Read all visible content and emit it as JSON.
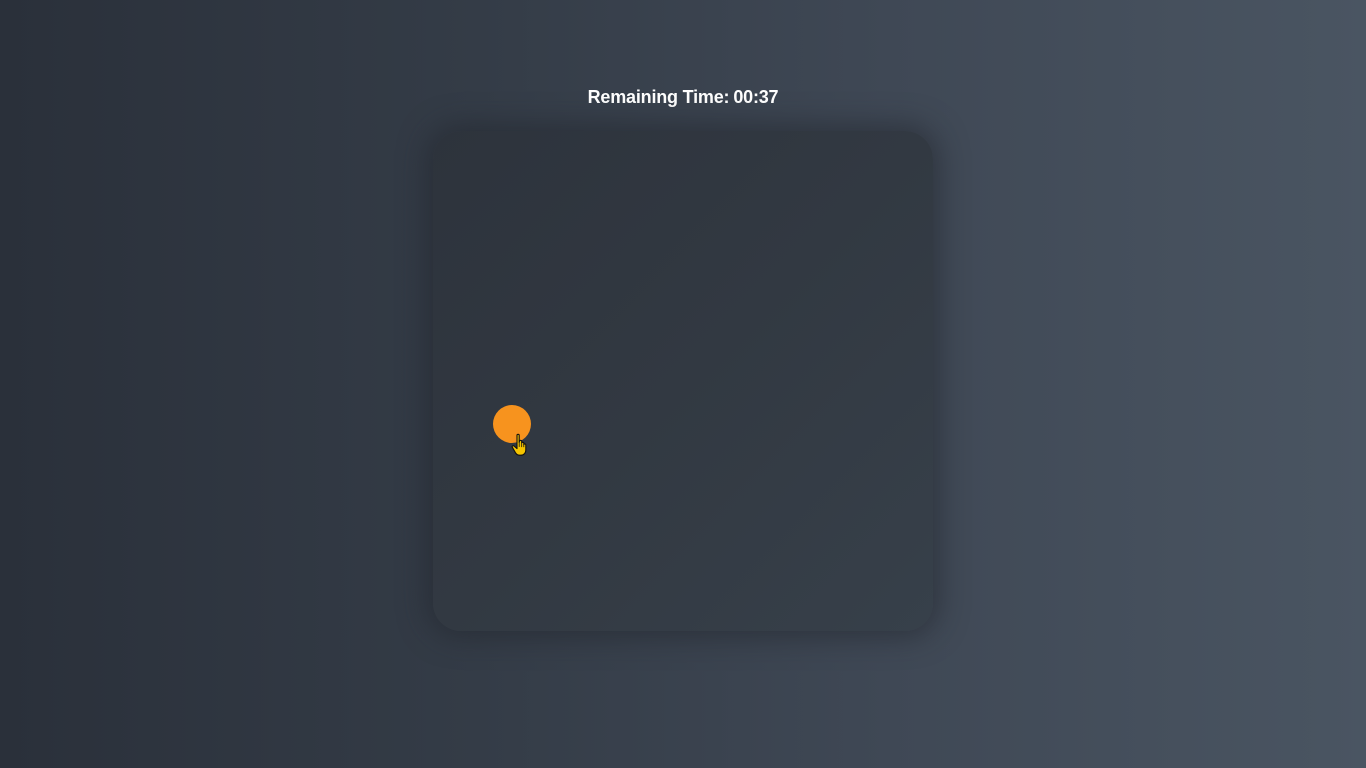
{
  "timer": {
    "label": "Remaining Time:",
    "value": "00:37"
  },
  "board": {
    "target": {
      "color": "#f7931e",
      "icon": "circle-target"
    },
    "cursor_icon": "hand-pointer-icon"
  },
  "colors": {
    "background_start": "#2a303a",
    "background_end": "#4a5562",
    "board": "#323942",
    "target": "#f7931e",
    "text": "#ffffff"
  }
}
